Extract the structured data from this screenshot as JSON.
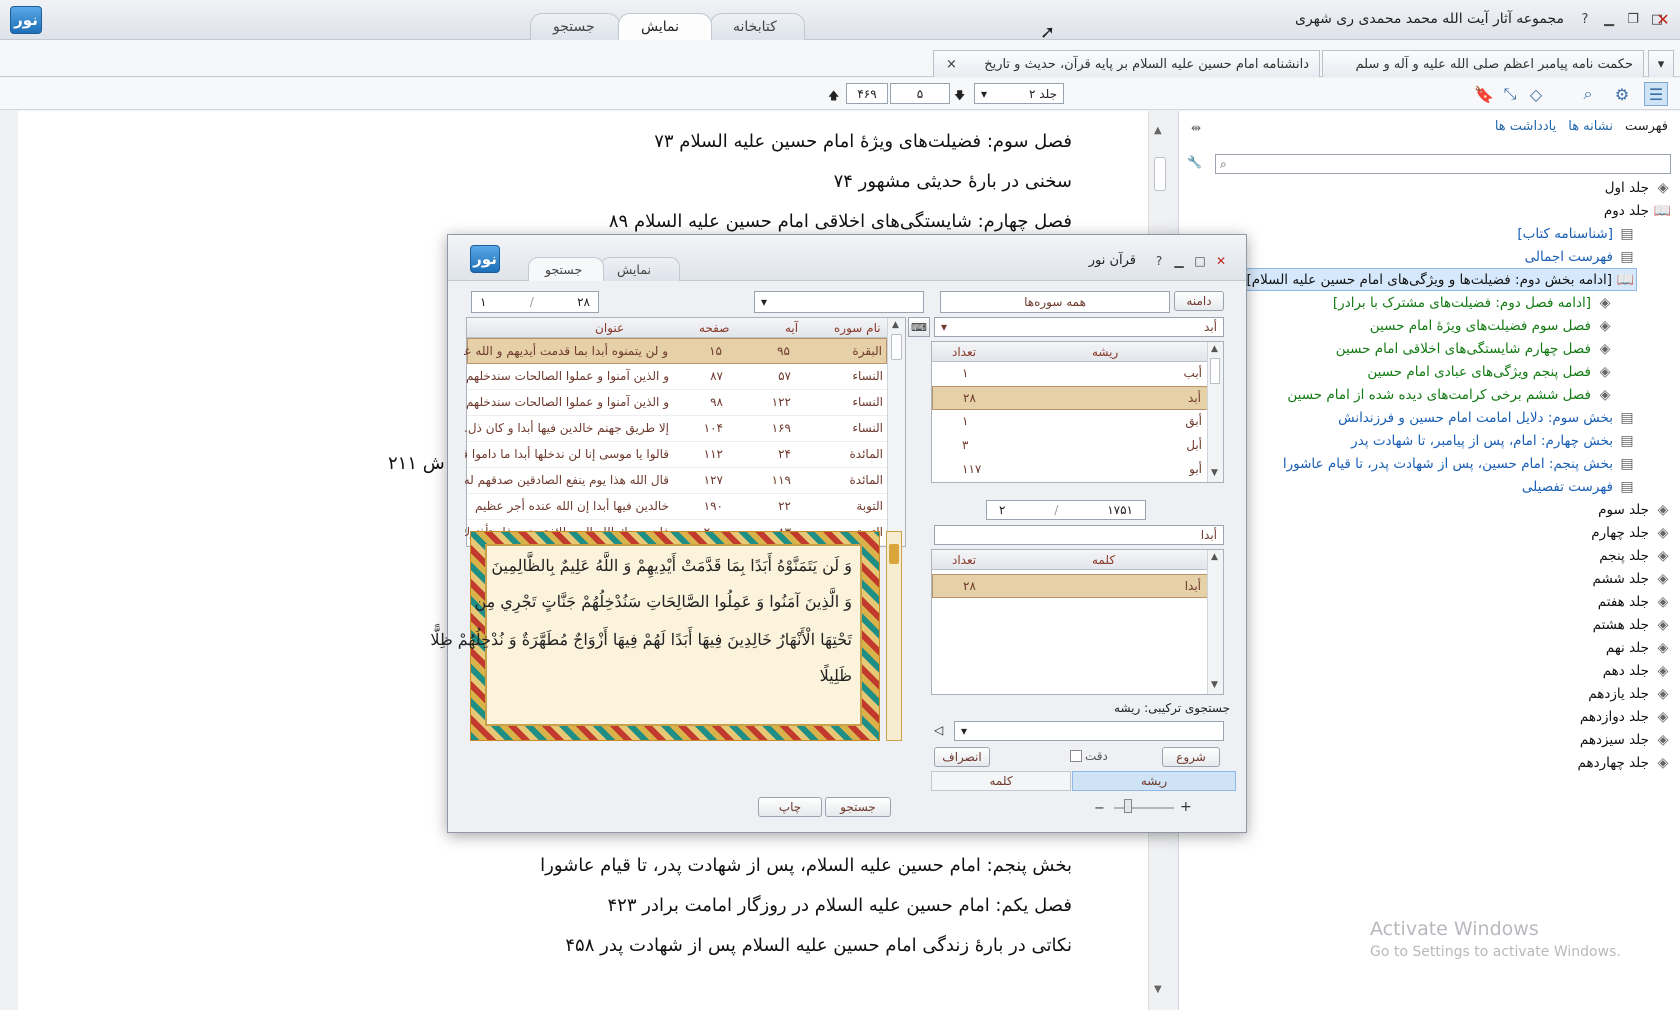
{
  "app": {
    "title": "مجموعه آثار آیت الله محمد محمدی ری شهری",
    "logo_text": "نور"
  },
  "top_tabs": [
    "کتابخانه",
    "نمایش",
    "جستجو"
  ],
  "doc_tabs": [
    {
      "label": "حکمت نامه پیامبر اعظم صلی الله علیه و آله و سلم"
    },
    {
      "label": "دانشنامه امام حسین علیه السلام بر پایه قرآن، حدیث و تاریخ",
      "close": "×"
    }
  ],
  "toolbar": {
    "volume": "جلد ۲",
    "page": "۵",
    "total_pages": "۴۶۹"
  },
  "doc_lines_top": [
    "فصل سوم: فضیلت‌های ویژهٔ امام حسین علیه السلام ۷۳",
    "سخنی در بارهٔ حدیثی مشهور ۷۴",
    "فصل چهارم: شایستگی‌های اخلاقی امام حسین علیه السلام ۸۹"
  ],
  "doc_partial": "ش ۲۱۱",
  "doc_lines_bottom": [
    "بخش پنجم: امام حسین علیه السلام، پس از شهادت پدر، تا قیام عاشورا",
    "فصل یکم: امام حسین علیه السلام در روزگار امامت برادر ۴۲۳",
    "نکاتی در بارهٔ زندگی امام حسین علیه السلام پس از شهادت پدر ۴۵۸"
  ],
  "side": {
    "tabs": [
      "فهرست",
      "نشانه ها",
      "یادداشت ها"
    ],
    "tree": [
      {
        "label": "جلد اول",
        "kind": "vol"
      },
      {
        "label": "جلد دوم",
        "kind": "vol"
      },
      {
        "label": "[شناسنامه کتاب]",
        "kind": "blue"
      },
      {
        "label": "فهرست اجمالی",
        "kind": "blue"
      },
      {
        "label": "[ادامه بخش دوم: فضیلت‌ها و ویژگی‌های امام حسین علیه السلام]",
        "kind": "sel"
      },
      {
        "label": "[ادامه فصل دوم: فضیلت‌های مشترک با برادر]",
        "kind": "green"
      },
      {
        "label": "فصل سوم فضیلت‌های ویژهٔ امام حسین",
        "kind": "green"
      },
      {
        "label": "فصل چهارم شایستگی‌های اخلاقی امام حسین",
        "kind": "green"
      },
      {
        "label": "فصل پنجم ویژگی‌های عبادی امام حسین",
        "kind": "green"
      },
      {
        "label": "فصل ششم برخی کرامت‌های دیده شده از امام حسین",
        "kind": "green"
      },
      {
        "label": "بخش سوم: دلایل امامت امام حسین و فرزندانش",
        "kind": "blue"
      },
      {
        "label": "بخش چهارم: امام، پس از پیامبر، تا شهادت پدر",
        "kind": "blue"
      },
      {
        "label": "بخش پنجم: امام حسین، پس از شهادت پدر، تا قیام عاشورا",
        "kind": "blue"
      },
      {
        "label": "فهرست تفصیلی",
        "kind": "blue"
      },
      {
        "label": "جلد سوم",
        "kind": "vol"
      },
      {
        "label": "جلد چهارم",
        "kind": "vol"
      },
      {
        "label": "جلد پنجم",
        "kind": "vol"
      },
      {
        "label": "جلد ششم",
        "kind": "vol"
      },
      {
        "label": "جلد هفتم",
        "kind": "vol"
      },
      {
        "label": "جلد هشتم",
        "kind": "vol"
      },
      {
        "label": "جلد نهم",
        "kind": "vol"
      },
      {
        "label": "جلد دهم",
        "kind": "vol"
      },
      {
        "label": "جلد یازدهم",
        "kind": "vol"
      },
      {
        "label": "جلد دوازدهم",
        "kind": "vol"
      },
      {
        "label": "جلد سیزدهم",
        "kind": "vol"
      },
      {
        "label": "جلد چهاردهم",
        "kind": "vol"
      }
    ]
  },
  "watermark": {
    "line1": "Activate Windows",
    "line2": "Go to Settings to activate Windows."
  },
  "dialog": {
    "title": "قرآن نور",
    "tabs": [
      "نمایش",
      "جستجو"
    ],
    "scope_label": "دامنه",
    "scope_value": "همه سوره‌ها",
    "results_count": "۲۸",
    "results_page": "۱",
    "root_field": "أبد",
    "roots_header": [
      "ریشه",
      "تعداد"
    ],
    "roots": [
      {
        "root": "أبب",
        "count": "۱"
      },
      {
        "root": "أبد",
        "count": "۲۸"
      },
      {
        "root": "أبق",
        "count": "۱"
      },
      {
        "root": "أبل",
        "count": "۳"
      },
      {
        "root": "أبو",
        "count": "۱۱۷"
      }
    ],
    "roots_total": "۱۷۵۱",
    "roots_page": "۲",
    "word_field": "أبدا",
    "words_header": [
      "کلمه",
      "تعداد"
    ],
    "words": [
      {
        "word": "أبدا",
        "count": "۲۸"
      }
    ],
    "combo_label": "جستجوی ترکیبی: ریشه",
    "exact_label": "دقت",
    "start_btn": "شروع",
    "cancel_btn": "انصراف",
    "bottom_tabs": [
      "ریشه",
      "کلمه"
    ],
    "results_header": [
      "نام سوره",
      "آیه",
      "صفحه",
      "عنوان"
    ],
    "results": [
      {
        "sura": "البقرة",
        "aya": "۹۵",
        "page": "۱۵",
        "text": "و لن یتمنوه أبدا بما قدمت أیدیهم و الله عل..."
      },
      {
        "sura": "النساء",
        "aya": "۵۷",
        "page": "۸۷",
        "text": "و الذین آمنوا و عملوا الصالحات سندخلهم..."
      },
      {
        "sura": "النساء",
        "aya": "۱۲۲",
        "page": "۹۸",
        "text": "و الذین آمنوا و عملوا الصالحات سندخلهم..."
      },
      {
        "sura": "النساء",
        "aya": "۱۶۹",
        "page": "۱۰۴",
        "text": "إلا طریق جهنم خالدین فیها أبدا و کان ذل..."
      },
      {
        "sura": "المائدة",
        "aya": "۲۴",
        "page": "۱۱۲",
        "text": "قالوا یا موسی إنا لن ندخلها أبدا ما داموا فی..."
      },
      {
        "sura": "المائدة",
        "aya": "۱۱۹",
        "page": "۱۲۷",
        "text": "قال الله هذا یوم ینفع الصادقین صدقهم له..."
      },
      {
        "sura": "التوبة",
        "aya": "۲۲",
        "page": "۱۹۰",
        "text": "خالدین فیها أبدا إن الله عنده أجر عظیم"
      },
      {
        "sura": "التوبة",
        "aya": "۸۳",
        "page": "۲۰۰",
        "text": "فإن رجعك الله إلی طائفة منهم فاستأذنوك ل..."
      }
    ],
    "quran_lines": [
      "وَ لَن يَتَمَنَّوْهُ أَبَدًا بِمَا قَدَّمَتْ أَيْدِيهِمْ وَ اللَّهُ عَلِيمٌ بِالظَّالِمِينَ",
      "وَ الَّذِينَ آمَنُوا وَ عَمِلُوا الصَّالِحَاتِ سَنُدْخِلُهُمْ جَنَّاتٍ تَجْرِي مِن",
      "تَحْتِهَا الْأَنْهَارُ خَالِدِينَ فِيهَا أَبَدًا لَهُمْ فِيهَا أَزْوَاجٌ مُطَهَّرَةٌ وَ نُدْخِلُهُمْ ظِلًّا",
      "ظَلِيلًا"
    ],
    "search_btn": "جستجو",
    "print_btn": "چاپ"
  }
}
